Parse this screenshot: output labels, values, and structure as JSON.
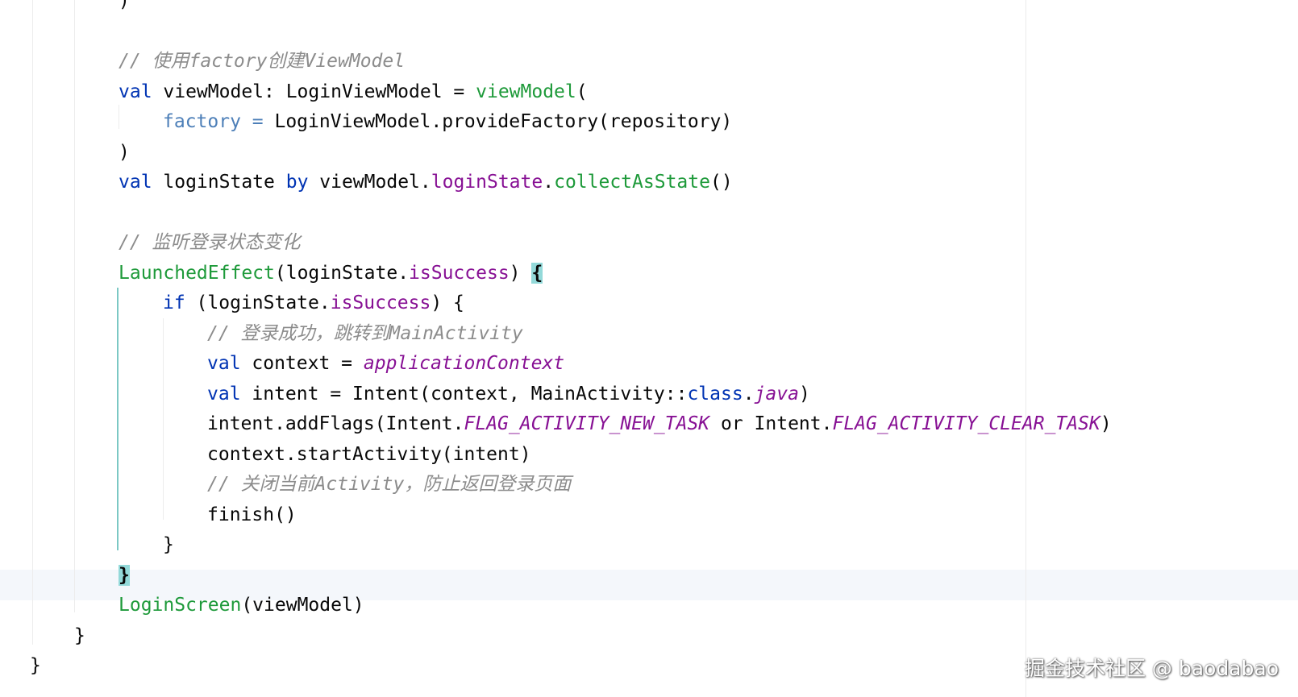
{
  "editor": {
    "lines": [
      {
        "indent": 3,
        "tokens": [
          {
            "text": ")",
            "cls": ""
          }
        ]
      },
      {
        "indent": 3,
        "tokens": []
      },
      {
        "indent": 3,
        "tokens": [
          {
            "text": "// 使用factory创建ViewModel",
            "cls": "comment"
          }
        ]
      },
      {
        "indent": 3,
        "tokens": [
          {
            "text": "val",
            "cls": "kw"
          },
          {
            "text": " viewModel: LoginViewModel = ",
            "cls": ""
          },
          {
            "text": "viewModel",
            "cls": "cfn"
          },
          {
            "text": "(",
            "cls": ""
          }
        ]
      },
      {
        "indent": 4,
        "tokens": [
          {
            "text": "factory",
            "cls": "param"
          },
          {
            "text": " = ",
            "cls": "param"
          },
          {
            "text": "LoginViewModel.provideFactory(repository)",
            "cls": ""
          }
        ]
      },
      {
        "indent": 3,
        "tokens": [
          {
            "text": ")",
            "cls": ""
          }
        ]
      },
      {
        "indent": 3,
        "tokens": [
          {
            "text": "val",
            "cls": "kw"
          },
          {
            "text": " loginState ",
            "cls": ""
          },
          {
            "text": "by",
            "cls": "kw"
          },
          {
            "text": " viewModel.",
            "cls": ""
          },
          {
            "text": "loginState",
            "cls": "prop"
          },
          {
            "text": ".",
            "cls": ""
          },
          {
            "text": "collectAsState",
            "cls": "cfn"
          },
          {
            "text": "()",
            "cls": ""
          }
        ]
      },
      {
        "indent": 3,
        "tokens": []
      },
      {
        "indent": 3,
        "tokens": [
          {
            "text": "// 监听登录状态变化",
            "cls": "comment"
          }
        ]
      },
      {
        "indent": 3,
        "tokens": [
          {
            "text": "LaunchedEffect",
            "cls": "cfn"
          },
          {
            "text": "(loginState.",
            "cls": ""
          },
          {
            "text": "isSuccess",
            "cls": "prop"
          },
          {
            "text": ") ",
            "cls": ""
          },
          {
            "text": "{",
            "cls": "brace-hl"
          }
        ]
      },
      {
        "indent": 4,
        "tokens": [
          {
            "text": "if",
            "cls": "kw"
          },
          {
            "text": " (loginState.",
            "cls": ""
          },
          {
            "text": "isSuccess",
            "cls": "prop"
          },
          {
            "text": ") {",
            "cls": ""
          }
        ]
      },
      {
        "indent": 5,
        "tokens": [
          {
            "text": "// 登录成功，跳转到MainActivity",
            "cls": "comment"
          }
        ]
      },
      {
        "indent": 5,
        "tokens": [
          {
            "text": "val",
            "cls": "kw"
          },
          {
            "text": " context = ",
            "cls": ""
          },
          {
            "text": "applicationContext",
            "cls": "prop italic"
          }
        ]
      },
      {
        "indent": 5,
        "tokens": [
          {
            "text": "val",
            "cls": "kw"
          },
          {
            "text": " intent = Intent(context, MainActivity::",
            "cls": ""
          },
          {
            "text": "class",
            "cls": "kw"
          },
          {
            "text": ".",
            "cls": ""
          },
          {
            "text": "java",
            "cls": "prop italic"
          },
          {
            "text": ")",
            "cls": ""
          }
        ]
      },
      {
        "indent": 5,
        "tokens": [
          {
            "text": "intent.addFlags(Intent.",
            "cls": ""
          },
          {
            "text": "FLAG_ACTIVITY_NEW_TASK",
            "cls": "prop italic"
          },
          {
            "text": " or Intent.",
            "cls": ""
          },
          {
            "text": "FLAG_ACTIVITY_CLEAR_TASK",
            "cls": "prop italic"
          },
          {
            "text": ")",
            "cls": ""
          }
        ]
      },
      {
        "indent": 5,
        "tokens": [
          {
            "text": "context.startActivity(intent)",
            "cls": ""
          }
        ]
      },
      {
        "indent": 5,
        "tokens": [
          {
            "text": "// 关闭当前Activity，防止返回登录页面",
            "cls": "comment"
          }
        ]
      },
      {
        "indent": 5,
        "tokens": [
          {
            "text": "finish()",
            "cls": ""
          }
        ]
      },
      {
        "indent": 4,
        "tokens": [
          {
            "text": "}",
            "cls": ""
          }
        ]
      },
      {
        "indent": 3,
        "tokens": [
          {
            "text": "}",
            "cls": "brace-hl"
          }
        ]
      },
      {
        "indent": 3,
        "tokens": [
          {
            "text": "LoginScreen",
            "cls": "cfn"
          },
          {
            "text": "(viewModel)",
            "cls": ""
          }
        ]
      },
      {
        "indent": 2,
        "tokens": [
          {
            "text": "}",
            "cls": ""
          }
        ]
      },
      {
        "indent": 1,
        "tokens": [
          {
            "text": "}",
            "cls": ""
          }
        ]
      }
    ]
  },
  "watermark": {
    "text": "掘金技术社区 @ baodabao"
  },
  "colors": {
    "keyword": "#0033b3",
    "composable": "#1e9a3a",
    "property": "#871094",
    "named_argument": "#4d7fb8",
    "comment": "#8c8c8c",
    "brace_match": "#93d9d9",
    "active_guide": "#7cc8c4"
  }
}
